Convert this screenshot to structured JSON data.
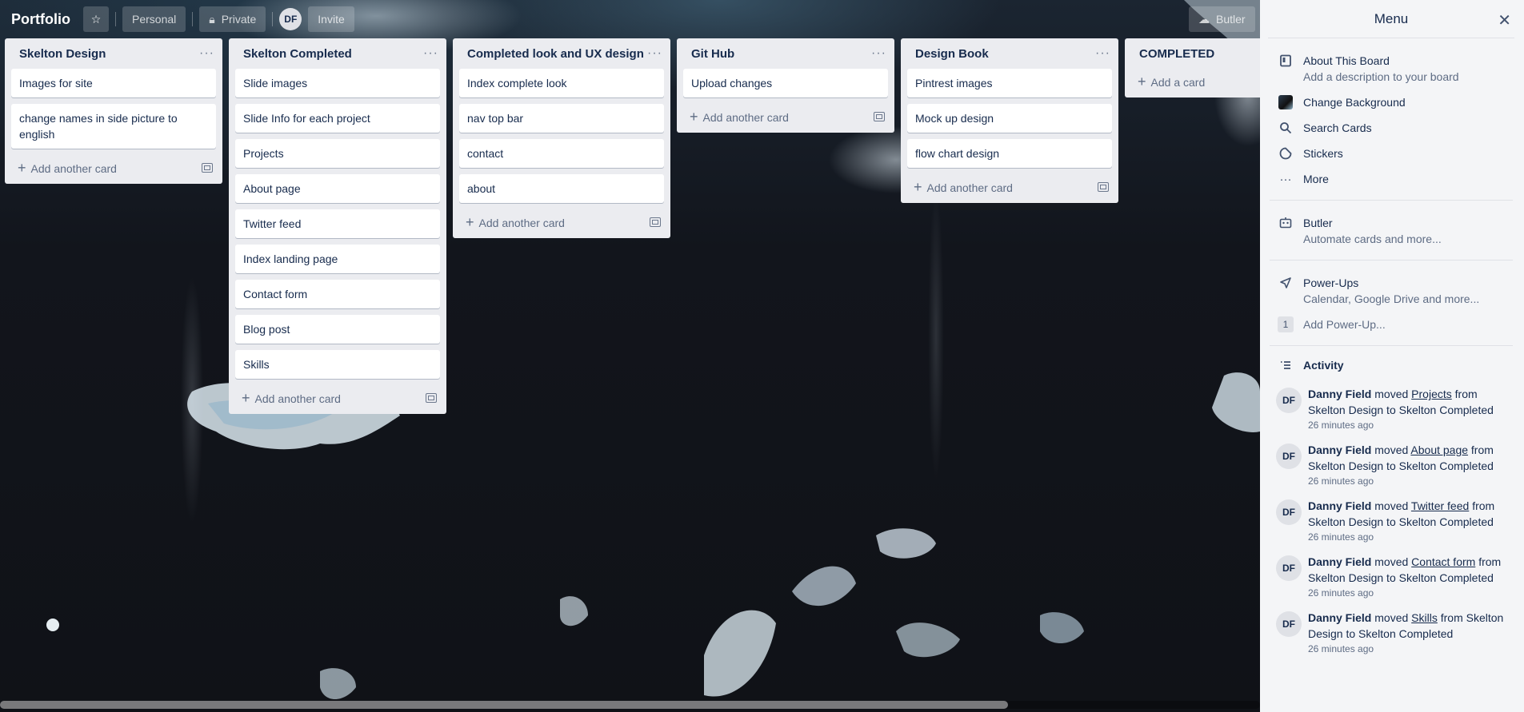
{
  "header": {
    "board_title": "Portfolio",
    "personal_label": "Personal",
    "private_label": "Private",
    "avatar_initials": "DF",
    "invite_label": "Invite",
    "butler_label": "Butler"
  },
  "lists": [
    {
      "title": "Skelton Design",
      "cards": [
        "Images for site",
        "change names in side picture to english"
      ],
      "add_label": "Add another card"
    },
    {
      "title": "Skelton Completed",
      "cards": [
        "Slide images",
        "Slide Info for each project",
        "Projects",
        "About page",
        "Twitter feed",
        "Index landing page",
        "Contact form",
        "Blog post",
        "Skills"
      ],
      "add_label": "Add another card"
    },
    {
      "title": "Completed look and UX design",
      "cards": [
        "Index complete look",
        "nav top bar",
        "contact",
        "about"
      ],
      "add_label": "Add another card"
    },
    {
      "title": "Git Hub",
      "cards": [
        "Upload changes"
      ],
      "add_label": "Add another card"
    },
    {
      "title": "Design Book",
      "cards": [
        "Pintrest images",
        "Mock up design",
        "flow chart design"
      ],
      "add_label": "Add another card"
    },
    {
      "title": "COMPLETED",
      "cards": [],
      "add_label": "Add a card"
    }
  ],
  "menu": {
    "title": "Menu",
    "about": {
      "label": "About This Board",
      "sub": "Add a description to your board"
    },
    "change_background": "Change Background",
    "search_cards": "Search Cards",
    "stickers": "Stickers",
    "more": "More",
    "butler": {
      "label": "Butler",
      "sub": "Automate cards and more..."
    },
    "powerups": {
      "label": "Power-Ups",
      "sub": "Calendar, Google Drive and more...",
      "count": "1",
      "add_label": "Add Power-Up..."
    },
    "activity_title": "Activity",
    "activity": [
      {
        "initials": "DF",
        "user": "Danny Field",
        "verb": "moved",
        "card": "Projects",
        "rest": "from Skelton Design to Skelton Completed",
        "time": "26 minutes ago"
      },
      {
        "initials": "DF",
        "user": "Danny Field",
        "verb": "moved",
        "card": "About page",
        "rest": "from Skelton Design to Skelton Completed",
        "time": "26 minutes ago"
      },
      {
        "initials": "DF",
        "user": "Danny Field",
        "verb": "moved",
        "card": "Twitter feed",
        "rest": "from Skelton Design to Skelton Completed",
        "time": "26 minutes ago"
      },
      {
        "initials": "DF",
        "user": "Danny Field",
        "verb": "moved",
        "card": "Contact form",
        "rest": "from Skelton Design to Skelton Completed",
        "time": "26 minutes ago"
      },
      {
        "initials": "DF",
        "user": "Danny Field",
        "verb": "moved",
        "card": "Skills",
        "rest": "from Skelton Design to Skelton Completed",
        "time": "26 minutes ago"
      }
    ]
  },
  "colors": {
    "list_bg": "#ebecf0",
    "menu_bg": "#f4f5f7",
    "text": "#172b4d"
  },
  "scroll": {
    "horizontal_fraction": 0.8
  }
}
